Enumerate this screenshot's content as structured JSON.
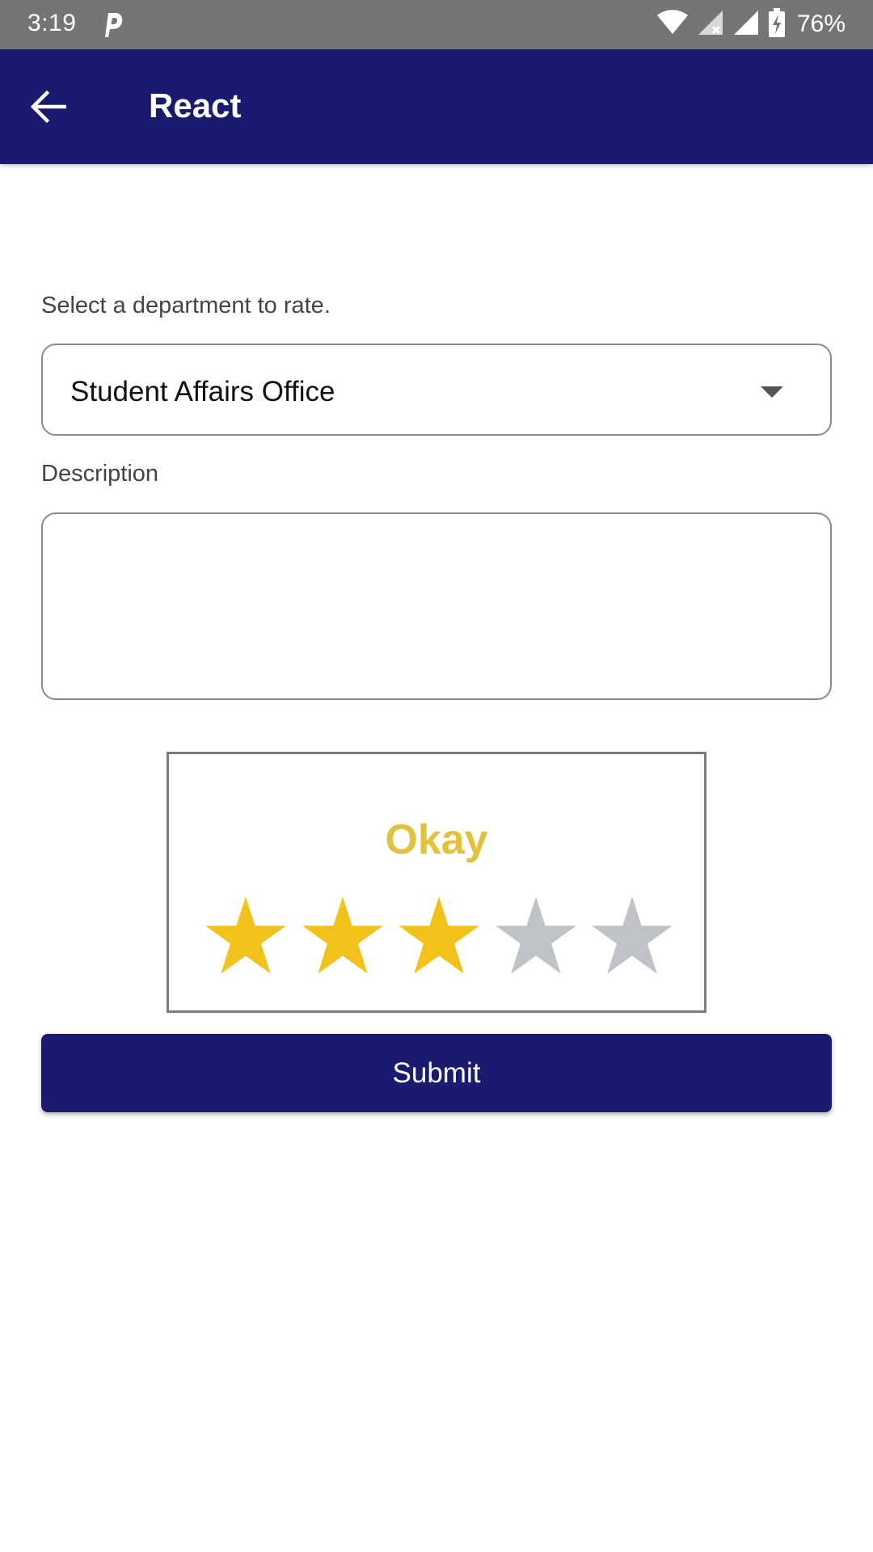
{
  "status_bar": {
    "time": "3:19",
    "battery": "76%",
    "icons": [
      "parking-icon",
      "wifi-icon",
      "signal-x-icon",
      "signal-icon",
      "battery-charging-icon"
    ]
  },
  "app_bar": {
    "title": "React",
    "back_icon": "arrow-back-icon",
    "background": "#1a1a6e"
  },
  "form": {
    "department_label": "Select a department to rate.",
    "department_value": "Student Affairs Office",
    "description_label": "Description",
    "description_value": ""
  },
  "rating": {
    "label": "Okay",
    "value": 3,
    "max": 5,
    "filled_color": "#f2c21a",
    "empty_color": "#bfc3c7",
    "label_color": "#e2c23c"
  },
  "submit": {
    "label": "Submit"
  }
}
